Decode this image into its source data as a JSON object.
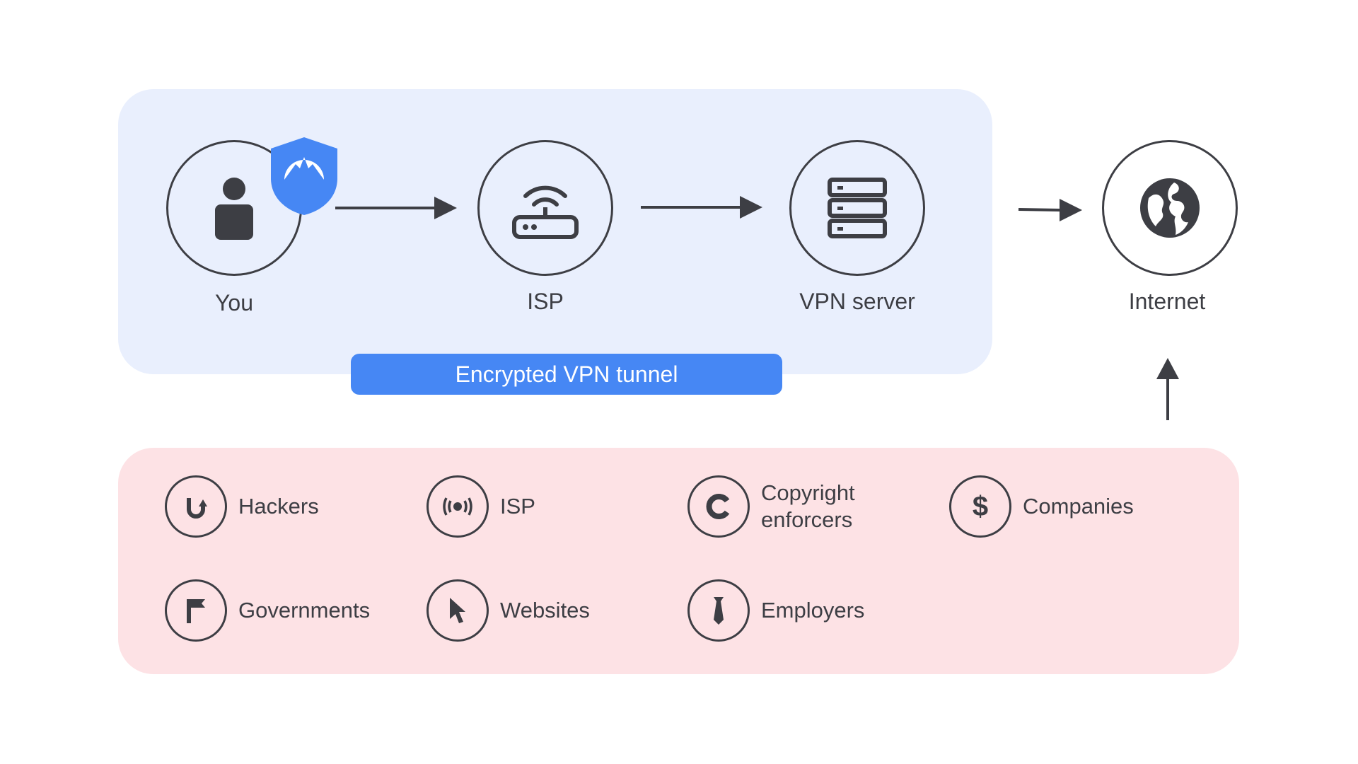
{
  "flow": {
    "nodes": [
      {
        "label": "You",
        "icon": "person-icon"
      },
      {
        "label": "ISP",
        "icon": "router-icon"
      },
      {
        "label": "VPN server",
        "icon": "server-icon"
      },
      {
        "label": "Internet",
        "icon": "globe-icon"
      }
    ],
    "tunnel_label": "Encrypted VPN tunnel",
    "shield_icon": "nordvpn-shield-icon"
  },
  "observers": [
    {
      "label": "Hackers",
      "icon": "hook-icon"
    },
    {
      "label": "ISP",
      "icon": "broadcast-icon"
    },
    {
      "label": "Copyright",
      "label2": "enforcers",
      "icon": "copyright-icon"
    },
    {
      "label": "Companies",
      "icon": "dollar-icon"
    },
    {
      "label": "Governments",
      "icon": "flag-icon"
    },
    {
      "label": "Websites",
      "icon": "cursor-icon"
    },
    {
      "label": "Employers",
      "icon": "tie-icon"
    }
  ],
  "colors": {
    "accent": "#4687f4",
    "tunnel_panel": "#e9effd",
    "observer_panel": "#fde2e5",
    "ink": "#3d3e44"
  }
}
